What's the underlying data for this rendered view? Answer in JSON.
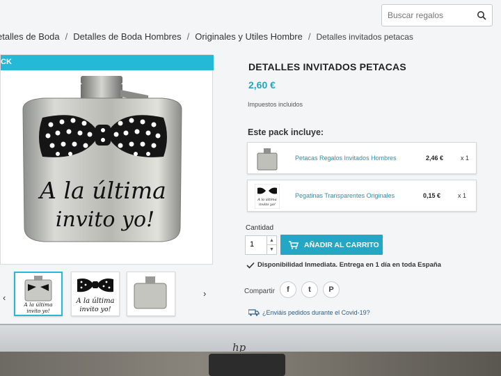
{
  "search": {
    "placeholder": "Buscar regalos"
  },
  "breadcrumb": [
    "etalles de Boda",
    "Detalles de Boda Hombres",
    "Originales y Utiles Hombre",
    "Detalles invitados petacas"
  ],
  "image_panel": {
    "band_label": "CK",
    "flask_text_line1": "A la última",
    "flask_text_line2": "invito yo!"
  },
  "thumbs": {
    "thumb1_line1": "A la última",
    "thumb1_line2": "invito yo!",
    "thumb2_line1": "A la última",
    "thumb2_line2": "invito yo!"
  },
  "product": {
    "title": "DETALLES INVITADOS PETACAS",
    "price": "2,60 €",
    "tax_note": "Impuestos incluidos",
    "pack_heading": "Este pack incluye:"
  },
  "pack_items": [
    {
      "name": "Petacas Regalos Invitados Hombres",
      "price": "2,46 €",
      "qty": "x 1"
    },
    {
      "name": "Pegatinas Transparentes Originales",
      "price": "0,15 €",
      "qty": "x 1",
      "thumb_line1": "A la última",
      "thumb_line2": "invito yo!"
    }
  ],
  "cart": {
    "qty_label": "Cantidad",
    "qty_value": "1",
    "add_button": "AÑADIR AL CARRITO"
  },
  "availability": "Disponibilidad Inmediata. Entrega en 1 día en toda España",
  "share_label": "Compartir",
  "social": {
    "facebook": "f",
    "twitter": "t",
    "pinterest": "P"
  },
  "covid_link": "¿Enviáis pedidos durante el Covid-19?",
  "colors": {
    "accent": "#24a7c5",
    "price": "#24a3c2",
    "band": "#24b9d7"
  },
  "icons": [
    "search-icon",
    "cart-icon",
    "check-icon",
    "truck-icon",
    "chevron-left-icon",
    "chevron-right-icon",
    "facebook-icon",
    "twitter-icon",
    "pinterest-icon",
    "hp-logo"
  ]
}
